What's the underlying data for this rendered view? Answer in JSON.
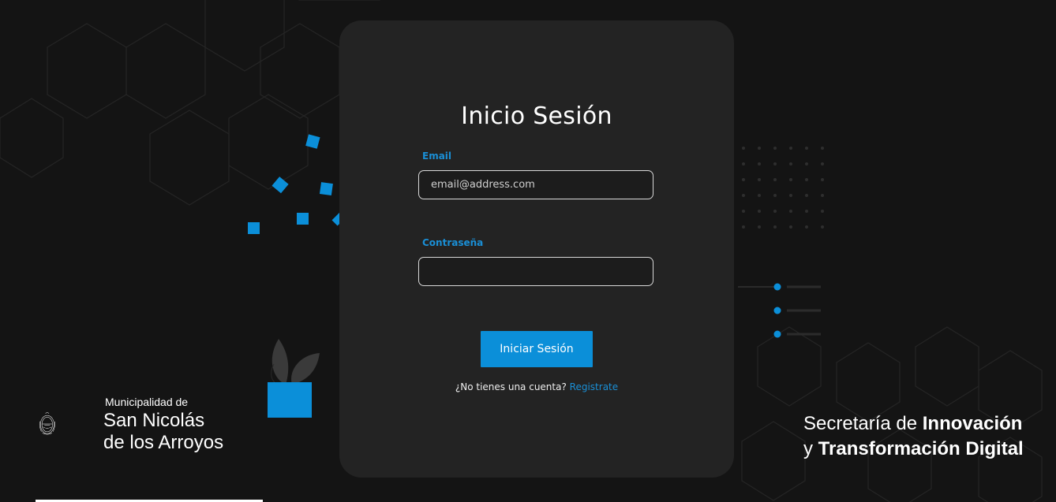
{
  "login": {
    "title": "Inicio Sesión",
    "email_label": "Email",
    "email_placeholder": "email@address.com",
    "password_label": "Contraseña",
    "password_placeholder": "",
    "submit_label": "Iniciar Sesión",
    "signup_prompt": "¿No tienes una cuenta?",
    "signup_link": "Registrate"
  },
  "brand_left": {
    "line1": "Municipalidad de",
    "line2": "San Nicolás",
    "line3": "de los Arroyos"
  },
  "brand_right": {
    "line1_light": "Secretaría de ",
    "line1_bold": "Innovación",
    "line2_light": "y ",
    "line2_bold": "Transformación Digital"
  },
  "colors": {
    "accent": "#0b8fd9",
    "background": "#141414",
    "card": "#232323"
  }
}
